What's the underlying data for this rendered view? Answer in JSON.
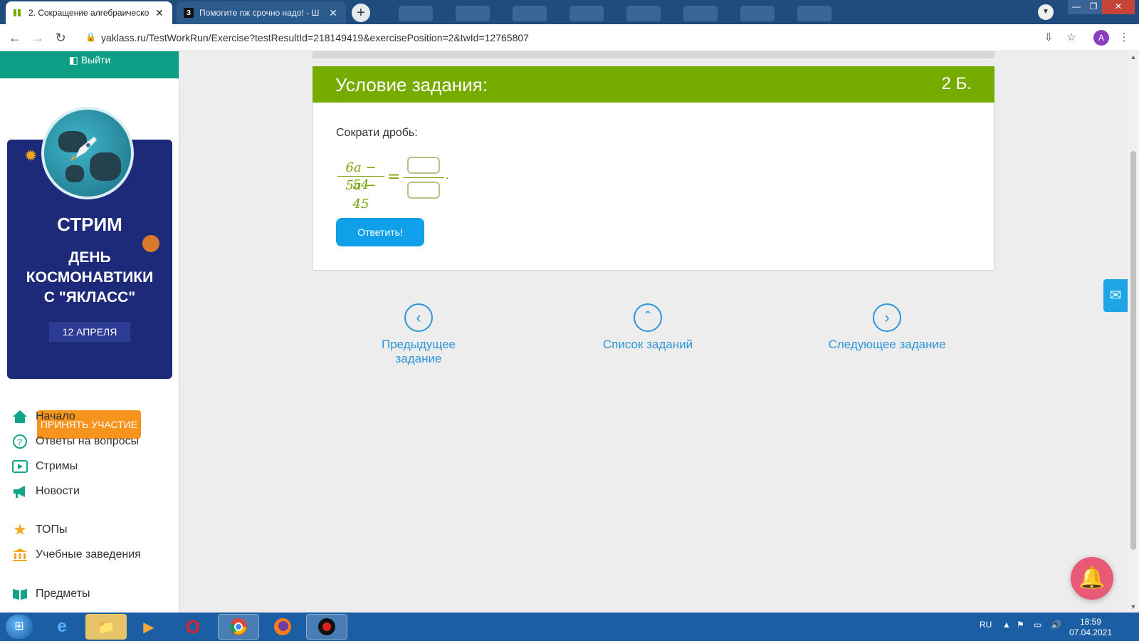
{
  "browser": {
    "tabs": [
      {
        "title": "2. Сокращение алгебраическо",
        "active": true
      },
      {
        "title": "Помогите пж срочно надо! - Ш",
        "active": false
      }
    ],
    "url": "yaklass.ru/TestWorkRun/Exercise?testResultId=218149419&exercisePosition=2&twId=12765807",
    "profile_initial": "A"
  },
  "sidebar": {
    "logout_label": "Выйти",
    "promo": {
      "title": "СТРИМ",
      "subtitle_line1": "ДЕНЬ",
      "subtitle_line2": "КОСМОНАВТИКИ",
      "subtitle_line3": "С \"ЯКЛАСС\"",
      "date": "12 АПРЕЛЯ",
      "button": "ПРИНЯТЬ УЧАСТИЕ"
    },
    "nav": [
      {
        "label": "Начало",
        "icon": "home-icon"
      },
      {
        "label": "Ответы на вопросы",
        "icon": "question-icon"
      },
      {
        "label": "Стримы",
        "icon": "play-icon"
      },
      {
        "label": "Новости",
        "icon": "megaphone-icon"
      },
      {
        "label": "ТОПы",
        "icon": "star-icon"
      },
      {
        "label": "Учебные заведения",
        "icon": "institution-icon"
      },
      {
        "label": "Предметы",
        "icon": "book-icon"
      }
    ]
  },
  "task": {
    "header": "Условие задания:",
    "points": "2 Б.",
    "instruction": "Сократи дробь:",
    "numerator": "6a − 54",
    "denominator": "5a − 45",
    "equals": "=",
    "submit": "Ответить!"
  },
  "navigation": {
    "prev": "Предыдущее задание",
    "list": "Список заданий",
    "next": "Следующее задание"
  },
  "taskbar": {
    "language": "RU",
    "time": "18:59",
    "date": "07.04.2021"
  },
  "colors": {
    "accent_green": "#76ab00",
    "link_blue": "#2d96d6",
    "button_blue": "#10a0ea",
    "promo_orange": "#f7941d"
  }
}
